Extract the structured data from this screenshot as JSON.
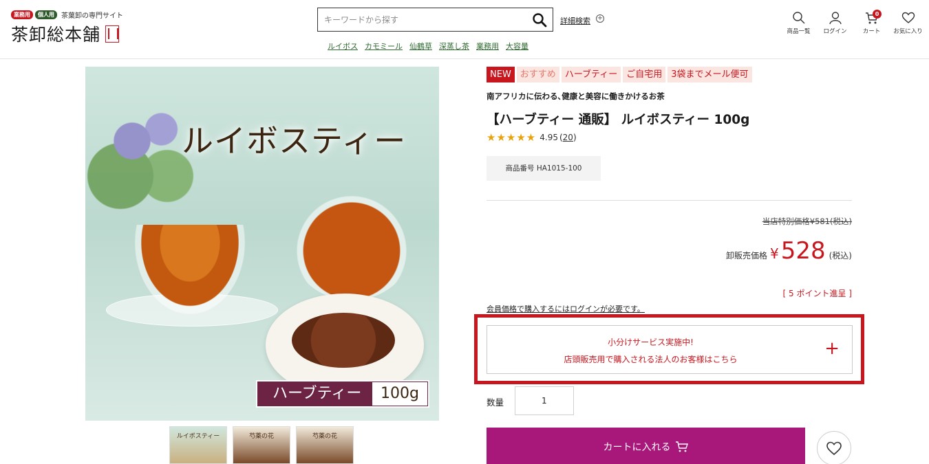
{
  "header": {
    "badge_business": "業務用",
    "badge_personal": "個人用",
    "tagline": "茶葉卸の専門サイト",
    "logo": "茶卸総本舗",
    "search_placeholder": "キーワードから探す",
    "advanced_search": "詳細検索",
    "quick_links": [
      "ルイボス",
      "カモミール",
      "仙鶴草",
      "深蒸し茶",
      "業務用",
      "大容量"
    ],
    "icons": {
      "products": "商品一覧",
      "login": "ログイン",
      "cart": "カート",
      "cart_count": "0",
      "favorites": "お気に入り"
    }
  },
  "gallery": {
    "image_title": "ルイボスティー",
    "image_label_category": "ハーブティー",
    "image_label_size": "100g",
    "thumbnails": [
      "ルイボスティー",
      "芍薬の花",
      "芍薬の花"
    ]
  },
  "product": {
    "tags": [
      "NEW",
      "おすすめ",
      "ハーブティー",
      "ご自宅用",
      "3袋までメール便可"
    ],
    "catchcopy": "南アフリカに伝わる､健康と美容に働きかけるお茶",
    "title": "【ハーブティー 通販】 ルイボスティー 100g",
    "stars": "★★★★★",
    "rating": "4.95",
    "review_count": "20",
    "sku": "商品番号 HA1015-100",
    "original_price": "当店特別価格¥581(税込)",
    "sale_label": "卸販売価格",
    "currency": "¥",
    "sale_price": "528",
    "tax_label": "(税込)",
    "points": "[ 5 ポイント進呈 ]",
    "login_note": "会員価格で購入するにはログインが必要です。",
    "service_line1": "小分けサービス実施中!",
    "service_line2": "店頭販売用で購入される法人のお客様はこちら",
    "quantity_label": "数量",
    "quantity_value": "1",
    "add_to_cart": "カートに入れる"
  },
  "colors": {
    "brand_red": "#c8161e",
    "cart_button": "#a8187b",
    "link_green": "#2d6a2e",
    "star": "#e8a30c"
  }
}
